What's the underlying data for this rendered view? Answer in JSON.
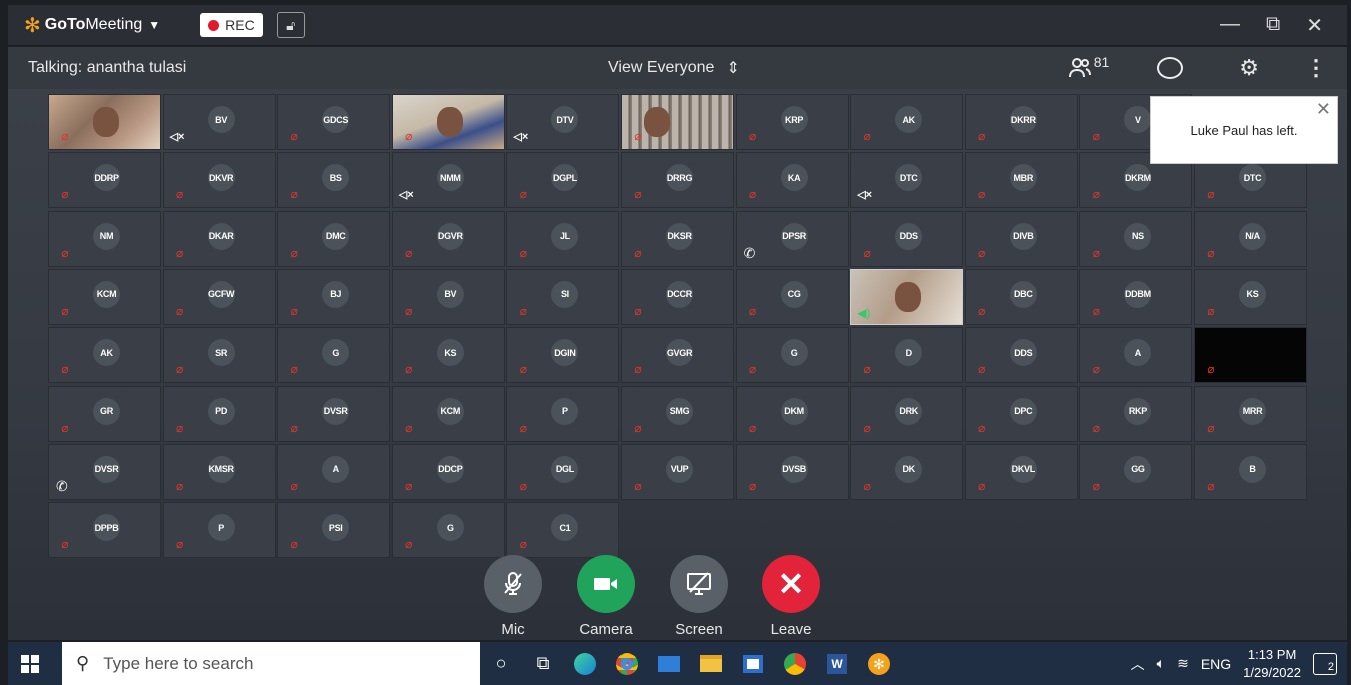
{
  "titlebar": {
    "app_name_bold": "GoTo",
    "app_name_rest": "Meeting",
    "rec_label": "REC",
    "minimize": "—",
    "restore": "⧉",
    "close": "✕"
  },
  "topbar": {
    "talking": "Talking: anantha tulasi",
    "view_label": "View Everyone",
    "attendee_count": "81"
  },
  "toast": {
    "message": "Luke Paul has left."
  },
  "participants": [
    [
      "cam1",
      "BV",
      "GDCS",
      "cam2",
      "DTV",
      "cam3",
      "KRP",
      "AK",
      "DKRR",
      "V",
      ""
    ],
    [
      "DDRP",
      "DKVR",
      "BS",
      "NMM",
      "DGPL",
      "DRRG",
      "KA",
      "DTC",
      "MBR",
      "DKRM",
      "DTC"
    ],
    [
      "NM",
      "DKAR",
      "DMC",
      "DGVR",
      "JL",
      "DKSR",
      "DPSR",
      "DDS",
      "DIVB",
      "NS",
      "N/A"
    ],
    [
      "KCM",
      "GCFW",
      "BJ",
      "BV",
      "SI",
      "DCCR",
      "CG",
      "cam4",
      "DBC",
      "DDBM",
      "KS"
    ],
    [
      "AK",
      "SR",
      "G",
      "KS",
      "DGIN",
      "GVGR",
      "G",
      "D",
      "DDS",
      "A",
      "black"
    ],
    [
      "GR",
      "PD",
      "DVSR",
      "KCM",
      "P",
      "SMG",
      "DKM",
      "DRK",
      "DPC",
      "RKP",
      "MRR"
    ],
    [
      "DVSR",
      "KMSR",
      "A",
      "DDCP",
      "DGL",
      "VUP",
      "DVSB",
      "DK",
      "DKVL",
      "GG",
      "B"
    ],
    [
      "DPPB",
      "P",
      "PSI",
      "G",
      "C1"
    ]
  ],
  "controls": {
    "mic": "Mic",
    "camera": "Camera",
    "screen": "Screen",
    "leave": "Leave"
  },
  "taskbar": {
    "search_placeholder": "Type here to search",
    "lang": "ENG",
    "time": "1:13 PM",
    "date": "1/29/2022",
    "notif_count": "2"
  }
}
